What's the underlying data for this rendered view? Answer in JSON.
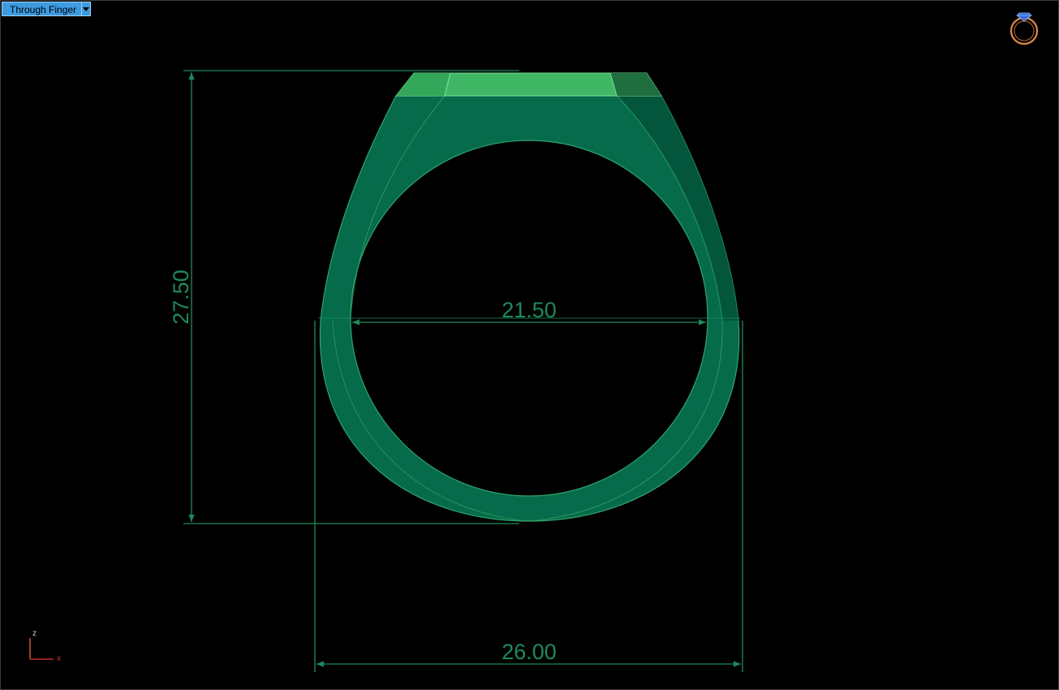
{
  "viewport": {
    "view_name": "Through Finger",
    "view_menu_icon": "chevron-down-icon",
    "nav_icon": "ring-icon",
    "axis_labels": {
      "vertical": "z",
      "horizontal": "x"
    }
  },
  "dimensions": {
    "height": "27.50",
    "inner_diameter": "21.50",
    "outer_width": "26.00"
  },
  "colors": {
    "background": "#000000",
    "ring_body": "#056b4a",
    "ring_top": "#3fb765",
    "dimension_line": "#1e8a5a",
    "tab": "#3d9be0",
    "axis_z": "#c85a3c",
    "axis_x": "#c82828"
  }
}
